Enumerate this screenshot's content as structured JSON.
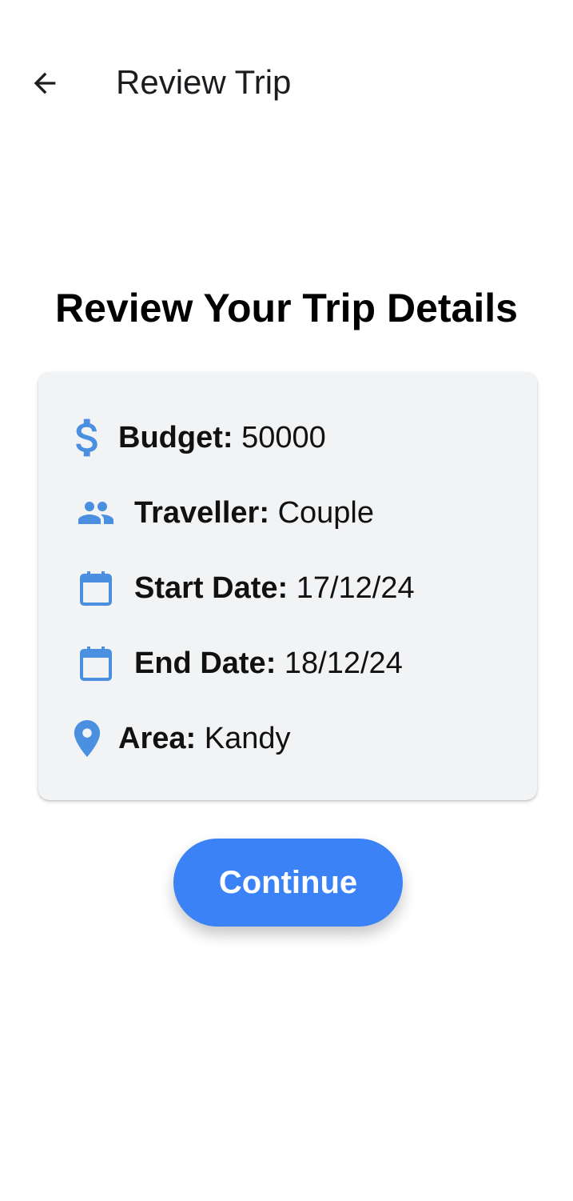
{
  "app_bar": {
    "title": "Review Trip",
    "back_icon": "arrow-left-icon"
  },
  "main": {
    "heading": "Review Your Trip Details",
    "details": [
      {
        "icon": "dollar-icon",
        "label": "Budget:",
        "value": "50000"
      },
      {
        "icon": "people-icon",
        "label": "Traveller:",
        "value": "Couple"
      },
      {
        "icon": "calendar-icon",
        "label": "Start Date:",
        "value": "17/12/24"
      },
      {
        "icon": "calendar-icon",
        "label": "End Date:",
        "value": "18/12/24"
      },
      {
        "icon": "location-pin-icon",
        "label": "Area:",
        "value": "Kandy"
      }
    ],
    "continue_label": "Continue"
  },
  "colors": {
    "accent": "#3b82f6",
    "icon": "#4a8fe0",
    "card_background": "#f2f3f5",
    "text": "#111111"
  }
}
